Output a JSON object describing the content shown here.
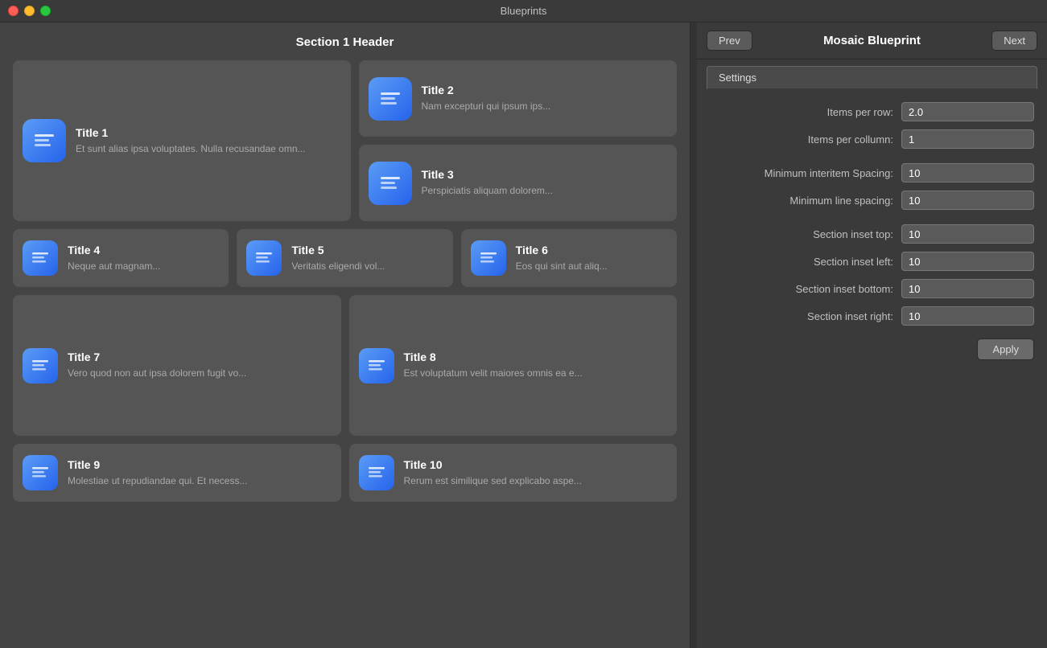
{
  "window": {
    "title": "Blueprints"
  },
  "header": {
    "prev_label": "Prev",
    "next_label": "Next",
    "panel_title": "Mosaic Blueprint"
  },
  "settings_tab": {
    "label": "Settings"
  },
  "section": {
    "header": "Section 1 Header"
  },
  "items": [
    {
      "id": 1,
      "title": "Title 1",
      "subtitle": "Et sunt alias ipsa voluptates. Nulla recusandae omn..."
    },
    {
      "id": 2,
      "title": "Title 2",
      "subtitle": "Nam excepturi qui ipsum ips..."
    },
    {
      "id": 3,
      "title": "Title 3",
      "subtitle": "Perspiciatis aliquam dolorem..."
    },
    {
      "id": 4,
      "title": "Title 4",
      "subtitle": "Neque aut magnam..."
    },
    {
      "id": 5,
      "title": "Title 5",
      "subtitle": "Veritatis eligendi vol..."
    },
    {
      "id": 6,
      "title": "Title 6",
      "subtitle": "Eos qui sint aut aliq..."
    },
    {
      "id": 7,
      "title": "Title 7",
      "subtitle": "Vero quod non aut ipsa dolorem fugit vo..."
    },
    {
      "id": 8,
      "title": "Title 8",
      "subtitle": "Est voluptatum velit maiores omnis ea e..."
    },
    {
      "id": 9,
      "title": "Title 9",
      "subtitle": "Molestiae ut repudiandae qui. Et necess..."
    },
    {
      "id": 10,
      "title": "Title 10",
      "subtitle": "Rerum est similique sed explicabo aspe..."
    }
  ],
  "form": {
    "items_per_row_label": "Items per row:",
    "items_per_row_value": "2.0",
    "items_per_column_label": "Items per collumn:",
    "items_per_column_value": "1",
    "min_interitem_label": "Minimum interitem Spacing:",
    "min_interitem_value": "10",
    "min_line_label": "Minimum line spacing:",
    "min_line_value": "10",
    "section_inset_top_label": "Section inset top:",
    "section_inset_top_value": "10",
    "section_inset_left_label": "Section inset left:",
    "section_inset_left_value": "10",
    "section_inset_bottom_label": "Section inset bottom:",
    "section_inset_bottom_value": "10",
    "section_inset_right_label": "Section inset right:",
    "section_inset_right_value": "10",
    "apply_label": "Apply"
  }
}
